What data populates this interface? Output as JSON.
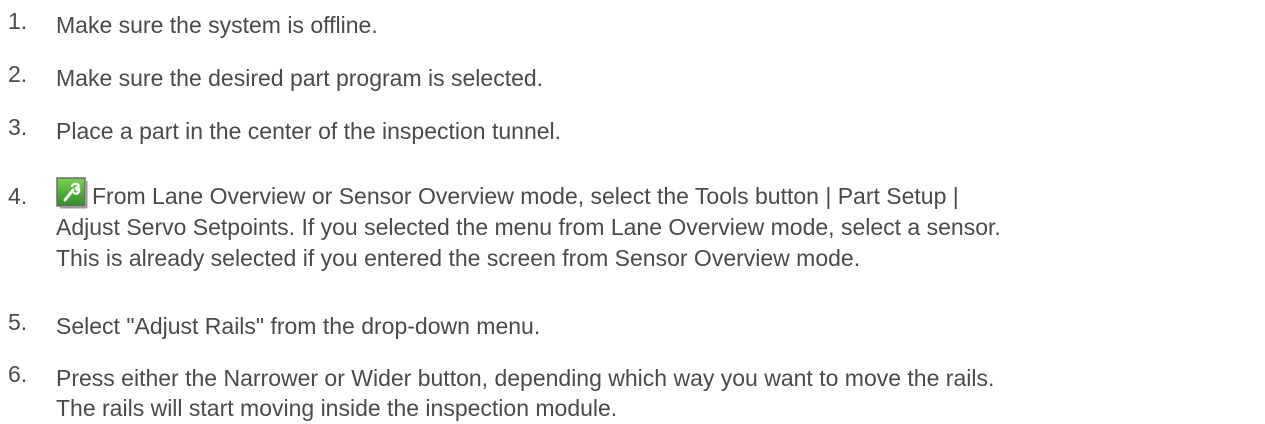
{
  "steps": [
    {
      "number": "1.",
      "lines": [
        "Make sure the system is offline."
      ]
    },
    {
      "number": "2.",
      "lines": [
        "Make sure the desired part program is selected."
      ]
    },
    {
      "number": "3.",
      "lines": [
        "Place a part in the center of the inspection tunnel."
      ]
    },
    {
      "number": "4.",
      "icon": "tools-wrench-icon",
      "lines": [
        "From Lane Overview or Sensor Overview mode, select the Tools button | Part Setup |",
        "Adjust Servo Setpoints. If you selected the menu from Lane Overview mode, select a sensor.",
        "This is already selected if you entered the screen from Sensor Overview mode."
      ]
    },
    {
      "number": "5.",
      "lines": [
        "Select \"Adjust Rails\" from the drop-down menu."
      ]
    },
    {
      "number": "6.",
      "lines": [
        "Press either the Narrower or Wider button, depending which way you want to move the rails.",
        "The rails will start moving inside the inspection module."
      ]
    }
  ],
  "colors": {
    "text": "#4a4a4a",
    "icon_green_dark": "#2e7d2e",
    "icon_green_light": "#5cbf3a"
  }
}
